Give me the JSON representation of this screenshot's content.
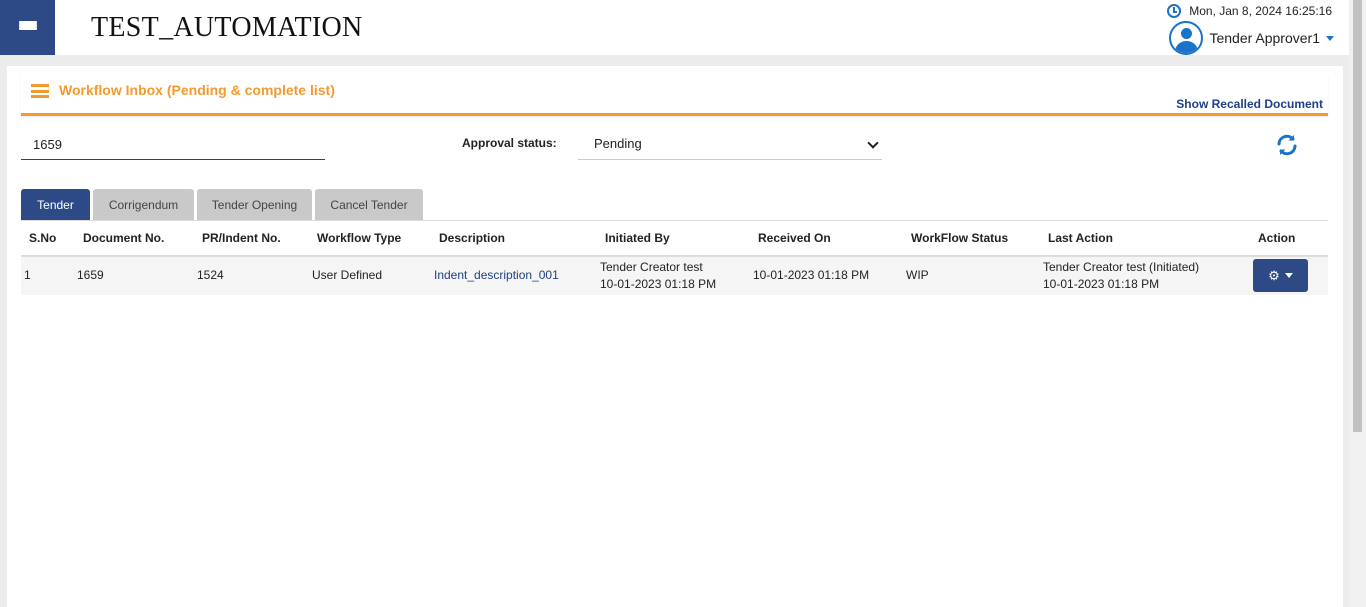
{
  "header": {
    "app_title": "TEST_AUTOMATION",
    "datetime": "Mon, Jan 8, 2024 16:25:16",
    "user_name": "Tender Approver1"
  },
  "panel": {
    "title": "Workflow Inbox (Pending & complete list)",
    "recalled_link": "Show Recalled Document"
  },
  "filters": {
    "search_value": "1659",
    "approval_label": "Approval status:",
    "approval_value": "Pending"
  },
  "tabs": [
    {
      "label": "Tender",
      "active": true
    },
    {
      "label": "Corrigendum",
      "active": false
    },
    {
      "label": "Tender Opening",
      "active": false
    },
    {
      "label": "Cancel Tender",
      "active": false
    }
  ],
  "table": {
    "headers": [
      "S.No",
      "Document No.",
      "PR/Indent No.",
      "Workflow Type",
      "Description",
      "Initiated By",
      "Received On",
      "WorkFlow Status",
      "Last Action",
      "Action"
    ],
    "rows": [
      {
        "sno": "1",
        "doc_no": "1659",
        "pr_no": "1524",
        "workflow_type": "User Defined",
        "description": "Indent_description_001",
        "initiated_by_name": "Tender Creator test",
        "initiated_by_date": "10-01-2023 01:18 PM",
        "received_on": "10-01-2023 01:18 PM",
        "status": "WIP",
        "last_action_text": "Tender Creator test (Initiated)",
        "last_action_date": "10-01-2023 01:18 PM"
      }
    ]
  },
  "colors": {
    "primary": "#2e4a86",
    "accent": "#f39a2e",
    "link": "#1f3f86",
    "info": "#1a73c9"
  },
  "icons": {
    "menu": "hamburger-icon",
    "clock": "clock-icon",
    "user": "user-avatar-icon",
    "panel": "list-icon",
    "refresh": "refresh-icon",
    "action": "gear-icon"
  }
}
